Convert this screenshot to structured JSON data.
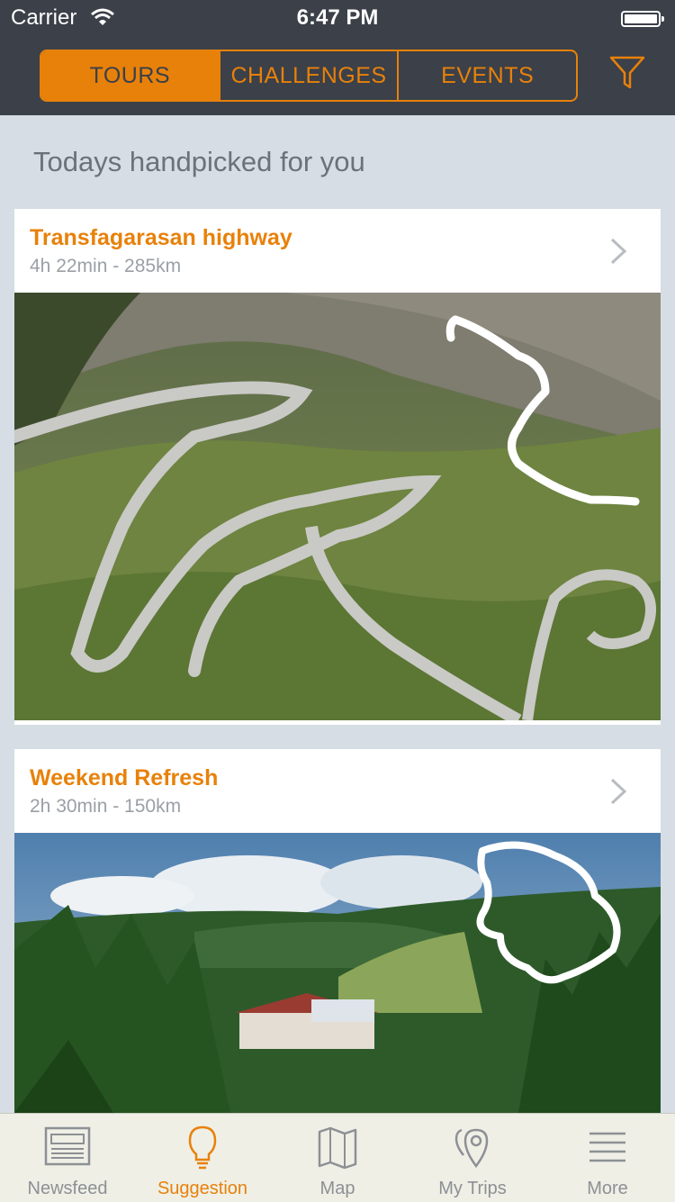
{
  "status_bar": {
    "carrier": "Carrier",
    "time": "6:47 PM"
  },
  "segments": [
    {
      "label": "TOURS",
      "active": true
    },
    {
      "label": "CHALLENGES",
      "active": false
    },
    {
      "label": "EVENTS",
      "active": false
    }
  ],
  "section_title": "Todays handpicked for you",
  "cards": [
    {
      "title": "Transfagarasan highway",
      "meta": "4h 22min - 285km"
    },
    {
      "title": "Weekend Refresh",
      "meta": "2h 30min - 150km"
    }
  ],
  "tabbar": [
    {
      "label": "Newsfeed",
      "icon": "newspaper-icon",
      "active": false
    },
    {
      "label": "Suggestion",
      "icon": "lightbulb-icon",
      "active": true
    },
    {
      "label": "Map",
      "icon": "map-icon",
      "active": false
    },
    {
      "label": "My Trips",
      "icon": "location-pins-icon",
      "active": false
    },
    {
      "label": "More",
      "icon": "menu-lines-icon",
      "active": false
    }
  ],
  "colors": {
    "accent": "#e8810a",
    "header": "#3b4049",
    "background": "#d6dde4"
  }
}
